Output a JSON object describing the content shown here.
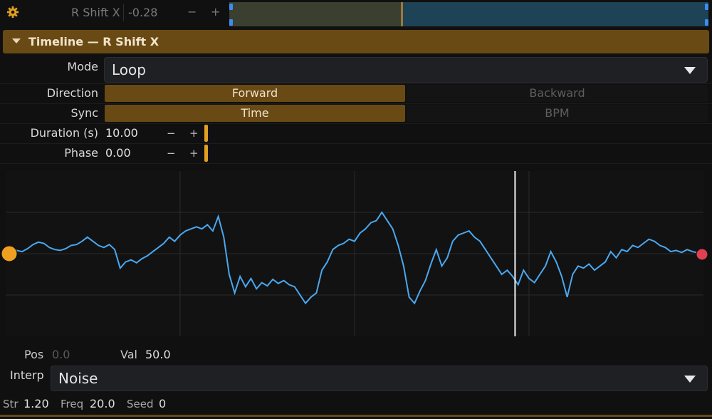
{
  "topbar": {
    "param_name": "R Shift X",
    "param_value": "-0.28",
    "minus": "−",
    "plus": "+",
    "range_progress": 0.36
  },
  "header": {
    "title": "Timeline — R Shift X"
  },
  "mode": {
    "label": "Mode",
    "value": "Loop"
  },
  "direction": {
    "label": "Direction",
    "options": [
      "Forward",
      "Backward"
    ],
    "selected": "Forward"
  },
  "sync": {
    "label": "Sync",
    "options": [
      "Time",
      "BPM"
    ],
    "selected": "Time"
  },
  "duration": {
    "label": "Duration (s)",
    "value": "10.00",
    "minus": "−",
    "plus": "+"
  },
  "phase": {
    "label": "Phase",
    "value": "0.00",
    "minus": "−",
    "plus": "+"
  },
  "curve": {
    "playhead": 0.73,
    "samples": [
      0,
      0.05,
      0.08,
      0.05,
      0.12,
      0.22,
      0.28,
      0.25,
      0.15,
      0.1,
      0.08,
      0.12,
      0.2,
      0.22,
      0.3,
      0.4,
      0.3,
      0.2,
      0.15,
      0.22,
      0.1,
      -0.35,
      -0.2,
      -0.15,
      -0.22,
      -0.12,
      -0.05,
      0.05,
      0.15,
      0.25,
      0.4,
      0.3,
      0.45,
      0.55,
      0.6,
      0.65,
      0.6,
      0.7,
      0.55,
      0.9,
      0.4,
      -0.5,
      -0.95,
      -0.55,
      -0.8,
      -0.6,
      -0.85,
      -0.7,
      -0.78,
      -0.62,
      -0.72,
      -0.65,
      -0.75,
      -0.8,
      -1.0,
      -1.2,
      -1.05,
      -0.95,
      -0.4,
      -0.2,
      0.1,
      0.2,
      0.25,
      0.35,
      0.3,
      0.5,
      0.6,
      0.75,
      0.8,
      1.0,
      0.8,
      0.6,
      0.2,
      -0.3,
      -1.05,
      -1.2,
      -0.9,
      -0.65,
      -0.25,
      0.1,
      -0.3,
      -0.1,
      0.3,
      0.45,
      0.5,
      0.55,
      0.4,
      0.3,
      0.1,
      -0.1,
      -0.3,
      -0.5,
      -0.4,
      -0.55,
      -0.75,
      -0.4,
      -0.6,
      -0.7,
      -0.5,
      -0.3,
      0.05,
      -0.2,
      -0.55,
      -1.05,
      -0.5,
      -0.3,
      -0.35,
      -0.25,
      -0.4,
      -0.3,
      -0.2,
      0.05,
      -0.1,
      0.1,
      0.05,
      0.2,
      0.15,
      0.25,
      0.35,
      0.3,
      0.2,
      0.15,
      0.05,
      0.08,
      0.03,
      0.1,
      0.05,
      0.02,
      0.0
    ],
    "start_color": "#f0a020",
    "end_color": "#e04050",
    "line_color": "#4aa8f0"
  },
  "pos": {
    "label": "Pos",
    "value": "0.0"
  },
  "val": {
    "label": "Val",
    "value": "50.0"
  },
  "interp": {
    "label": "Interp",
    "value": "Noise"
  },
  "noise": {
    "str_label": "Str",
    "str_value": "1.20",
    "freq_label": "Freq",
    "freq_value": "20.0",
    "seed_label": "Seed",
    "seed_value": "0"
  }
}
